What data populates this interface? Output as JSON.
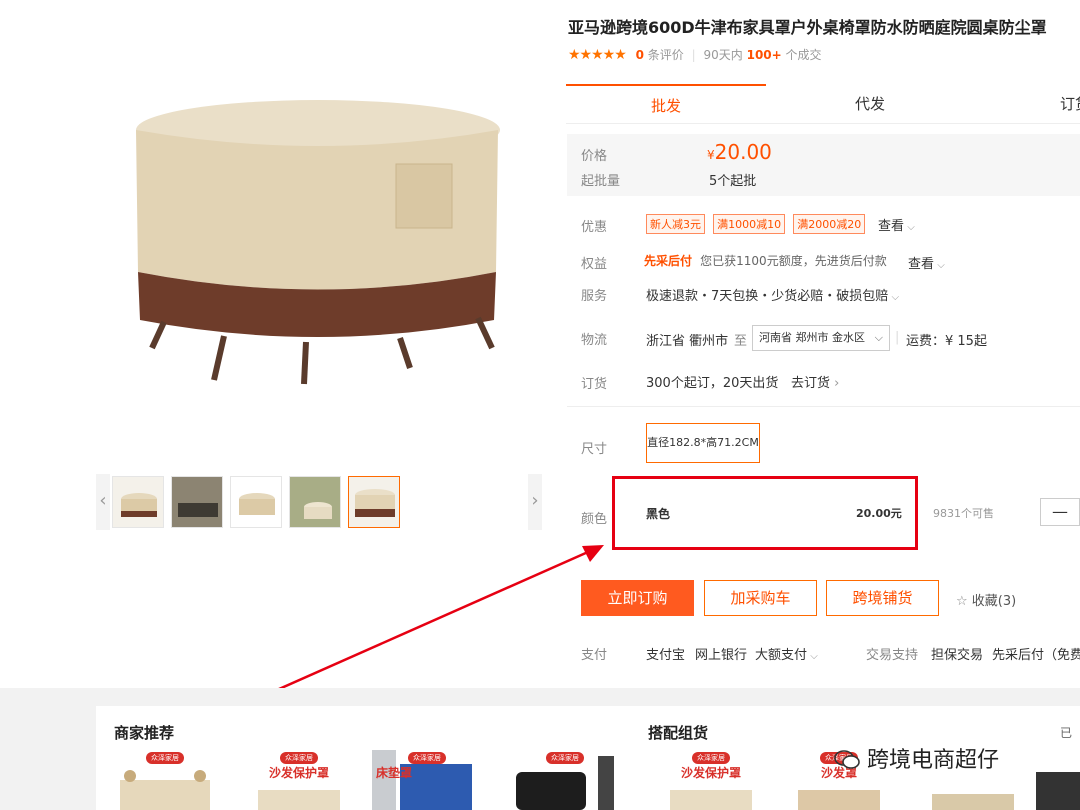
{
  "product": {
    "title": "亚马逊跨境600D牛津布家具罩户外桌椅罩防水防晒庭院圆桌防尘罩",
    "stars": "★★★★★",
    "review_count": "0",
    "review_suffix": "条评价",
    "period": "90天内",
    "deals": "100+",
    "deals_suffix": "个成交"
  },
  "tabs": [
    "批发",
    "代发",
    "订货"
  ],
  "price": {
    "price_label": "价格",
    "currency": "¥",
    "price_value": "20.00",
    "moq_label": "起批量",
    "moq_value": "5个起批"
  },
  "info": {
    "promo_label": "优惠",
    "promo_tags": [
      "新人减3元",
      "满1000减10",
      "满2000减20"
    ],
    "promo_more": "查看",
    "rights_label": "权益",
    "rights_highlight": "先采后付",
    "rights_text": "您已获1100元额度，先进货后付款",
    "rights_more": "查看",
    "service_label": "服务",
    "service_text": "极速退款・7天包换・少货必赔・破损包赔",
    "logistics_label": "物流",
    "logistics_from": "浙江省 衢州市",
    "logistics_to_word": "至",
    "logistics_dest": "河南省 郑州市 金水区",
    "logistics_fee": "运费：¥ 15起",
    "order_label": "订货",
    "order_text": "300个起订，20天出货",
    "order_link": "去订货"
  },
  "options": {
    "size_label": "尺寸",
    "size_value": "直径182.8*高71.2CM",
    "color_label": "颜色",
    "color_value": "黑色",
    "color_price": "20.00元",
    "stock": "9831个可售",
    "stepper_minus": "—"
  },
  "actions": {
    "buy_now": "立即订购",
    "add_cart": "加采购车",
    "cross_border": "跨境铺货",
    "favorite": "收藏(3)"
  },
  "payment": {
    "label": "支付",
    "methods": [
      "支付宝",
      "网上银行",
      "大额支付"
    ],
    "trade_label": "交易支持",
    "trade_items": [
      "担保交易",
      "先采后付（免费"
    ]
  },
  "bottom": {
    "merchant_rec": "商家推荐",
    "bundle": "搭配组货",
    "right_cut": "已",
    "rec_badge": "众泽家居",
    "rec_labels": [
      "",
      "沙发保护罩",
      "床垫罩",
      "",
      "",
      "沙发保护罩",
      "沙发罩",
      ""
    ],
    "watermark": "跨境电商超仔"
  },
  "colors": {
    "accent": "#ff5000",
    "highlight_box": "#e60012"
  }
}
